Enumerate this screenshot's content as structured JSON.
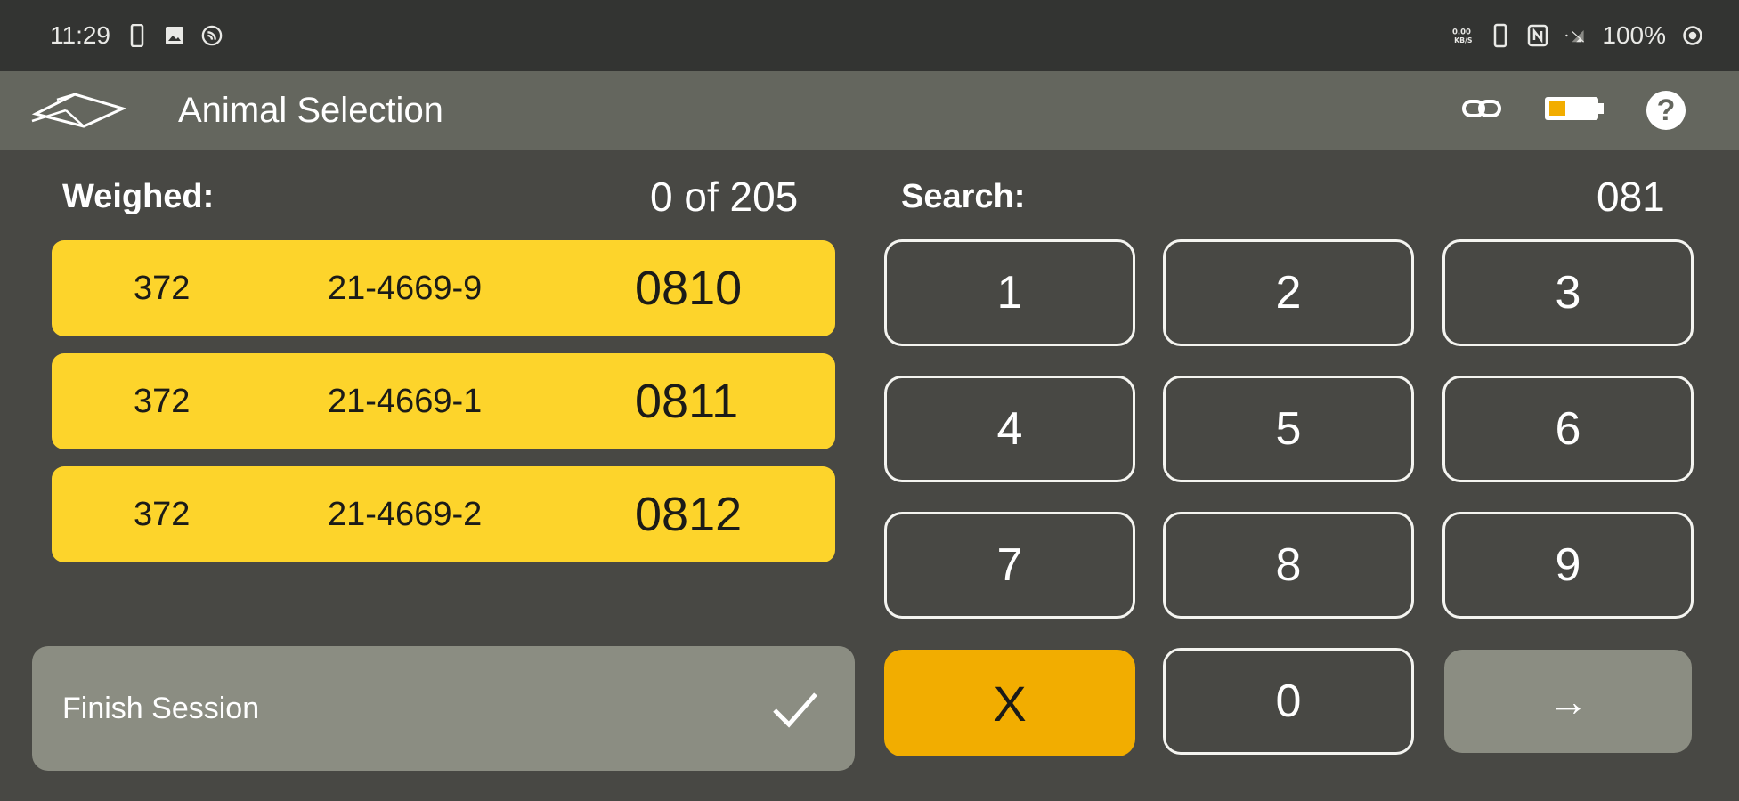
{
  "status_bar": {
    "time": "11:29",
    "left_icons": [
      "phone-icon",
      "image-icon",
      "cast-icon"
    ],
    "right_icons": [
      "data-speed-icon",
      "vibrate-icon",
      "nfc-icon",
      "signal-icon"
    ],
    "battery_percent": "100%"
  },
  "app_bar": {
    "title": "Animal Selection",
    "icons": [
      "link-icon",
      "battery-icon",
      "help-icon"
    ],
    "help_glyph": "?"
  },
  "weighed": {
    "label": "Weighed:",
    "value": "0 of 205"
  },
  "search": {
    "label": "Search:",
    "value": "081"
  },
  "animals": [
    {
      "group": "372",
      "tag": "21-4669-9",
      "id": "0810"
    },
    {
      "group": "372",
      "tag": "21-4669-1",
      "id": "0811"
    },
    {
      "group": "372",
      "tag": "21-4669-2",
      "id": "0812"
    }
  ],
  "finish": {
    "label": "Finish Session",
    "icon": "check-icon"
  },
  "keypad": {
    "k1": "1",
    "k2": "2",
    "k3": "3",
    "k4": "4",
    "k5": "5",
    "k6": "6",
    "k7": "7",
    "k8": "8",
    "k9": "9",
    "clear": "X",
    "k0": "0",
    "enter": "→"
  },
  "colors": {
    "background": "#484844",
    "status_bar": "#333432",
    "app_bar": "#64665e",
    "row_yellow": "#fdd42b",
    "clear_orange": "#f2ad00",
    "muted_button": "#8b8d82"
  }
}
